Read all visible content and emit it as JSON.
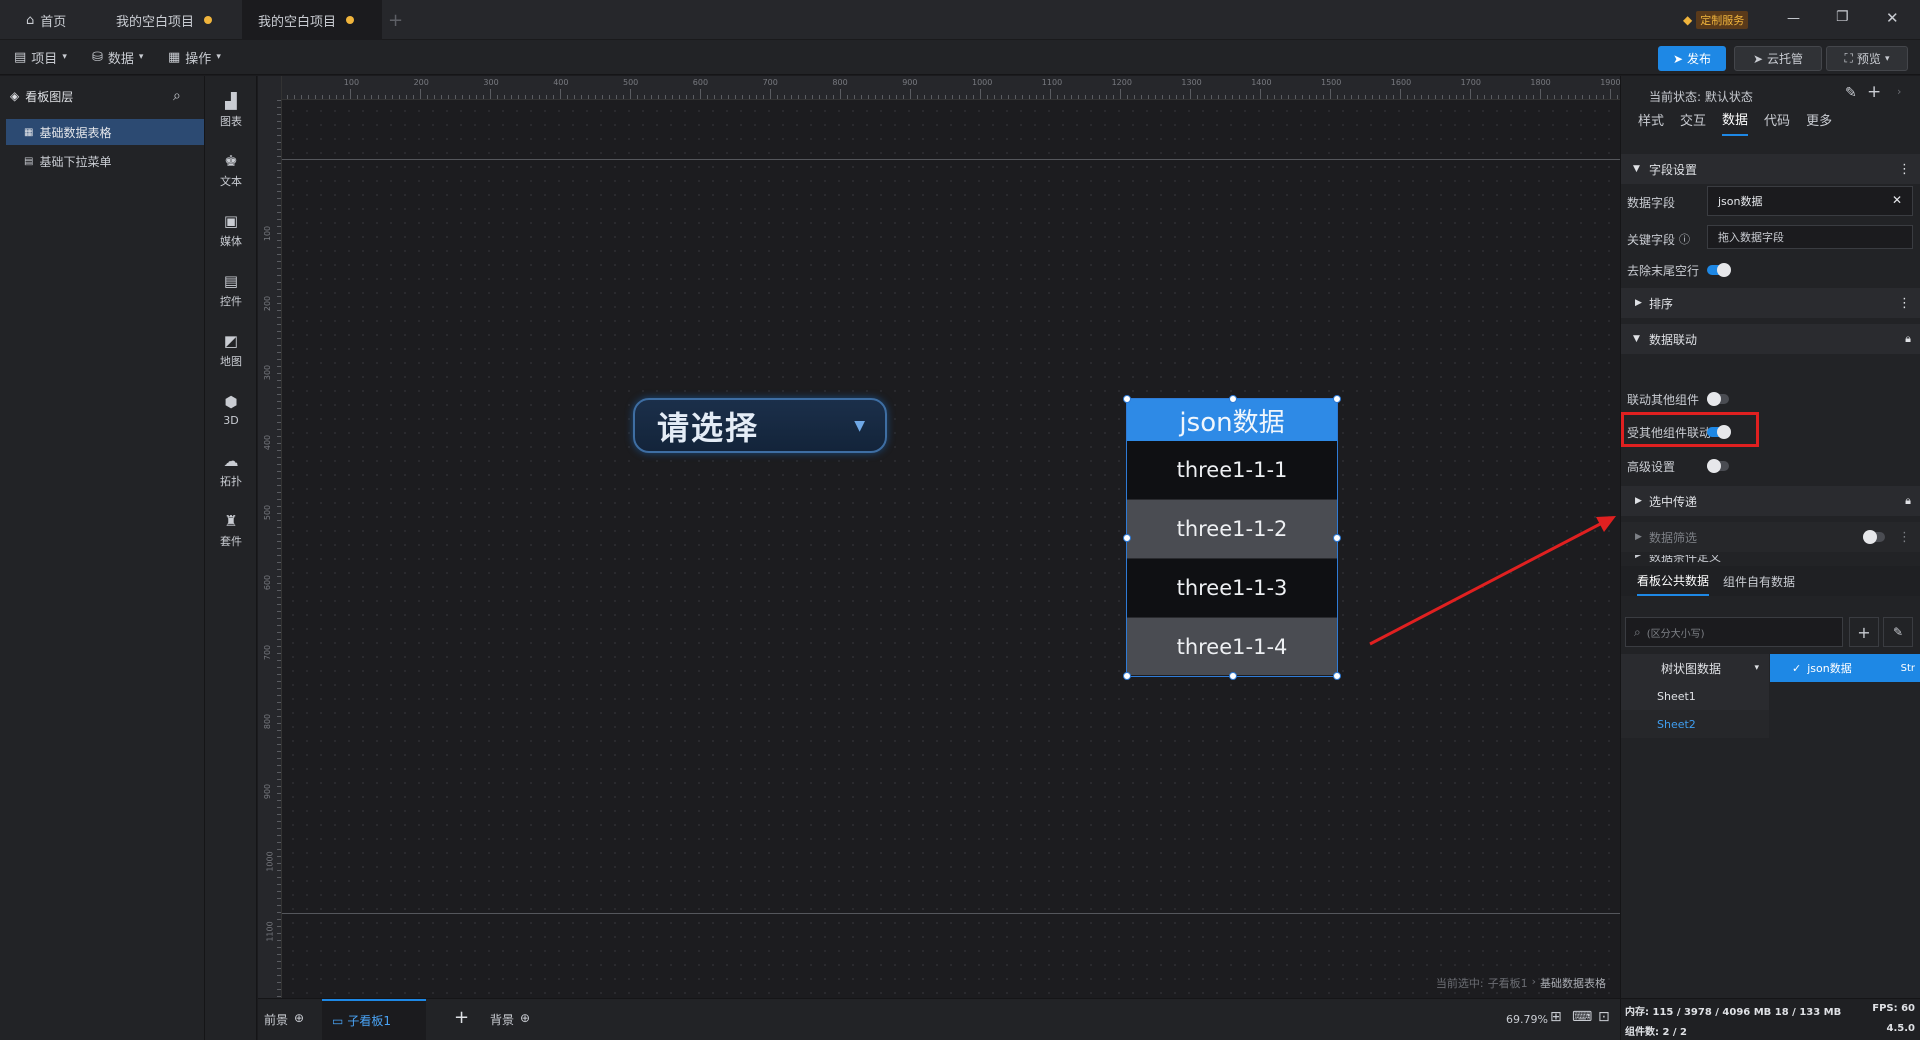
{
  "titlebar": {
    "home": "首页",
    "tabs": [
      "我的空白项目",
      "我的空白项目"
    ],
    "custom_service": "定制服务"
  },
  "toolbar": {
    "menus": [
      "项目",
      "数据",
      "操作"
    ],
    "publish": "发布",
    "cloud": "云托管",
    "preview": "预览"
  },
  "layers": {
    "title": "看板图层",
    "items": [
      "基础数据表格",
      "基础下拉菜单"
    ]
  },
  "iconbar": [
    "图表",
    "文本",
    "媒体",
    "控件",
    "地图",
    "3D",
    "拓扑",
    "套件"
  ],
  "ruler": {
    "h": [
      "100",
      "200",
      "300",
      "400",
      "500",
      "600",
      "700",
      "800",
      "900",
      "1000",
      "1100",
      "1200",
      "1300",
      "1400",
      "1500",
      "1600",
      "1700",
      "1800",
      "1900"
    ],
    "v": [
      "100",
      "200",
      "300",
      "400",
      "500",
      "600",
      "700",
      "800",
      "900",
      "1000",
      "1100"
    ]
  },
  "dropdown": {
    "placeholder": "请选择"
  },
  "table": {
    "header": "json数据",
    "rows": [
      "three1-1-1",
      "three1-1-2",
      "three1-1-3",
      "three1-1-4"
    ]
  },
  "canvas_status": {
    "prefix": "当前选中:",
    "path": "子看板1",
    "target": "基础数据表格"
  },
  "bottombar": {
    "front": "前景",
    "board": "子看板1",
    "background": "背景",
    "zoom": "69.79%"
  },
  "props": {
    "state": "当前状态: 默认状态",
    "tabs": [
      "样式",
      "交互",
      "数据",
      "代码",
      "更多"
    ],
    "active_tab": "数据",
    "field_section": "字段设置",
    "data_field_label": "数据字段",
    "data_field_value": "json数据",
    "key_field_label": "关键字段",
    "key_field_placeholder": "拖入数据字段",
    "trim_label": "去除末尾空行",
    "sort_section": "排序",
    "link_section": "数据联动",
    "link_other": "联动其他组件",
    "linked_by_other": "受其他组件联动",
    "advanced": "高级设置",
    "select_pass": "选中传递",
    "data_filter": "数据筛选",
    "data_condition": "数据条件定义",
    "data_tabs": [
      "看板公共数据",
      "组件自有数据"
    ],
    "search_placeholder": "(区分大小写)",
    "tree": {
      "group": "树状图数据",
      "items": [
        "Sheet1",
        "Sheet2"
      ]
    },
    "selected_data": "json数据",
    "selected_type": "Str"
  },
  "status": {
    "memory": "内存: 115 / 3978 / 4096 MB  18 / 133 MB",
    "fps": "FPS: 60",
    "components": "组件数: 2 / 2",
    "version": "4.5.0"
  },
  "colors": {
    "accent": "#1e88e5",
    "highlight": "#e02020",
    "panel": "#222326",
    "canvas": "#1c1c1f"
  }
}
